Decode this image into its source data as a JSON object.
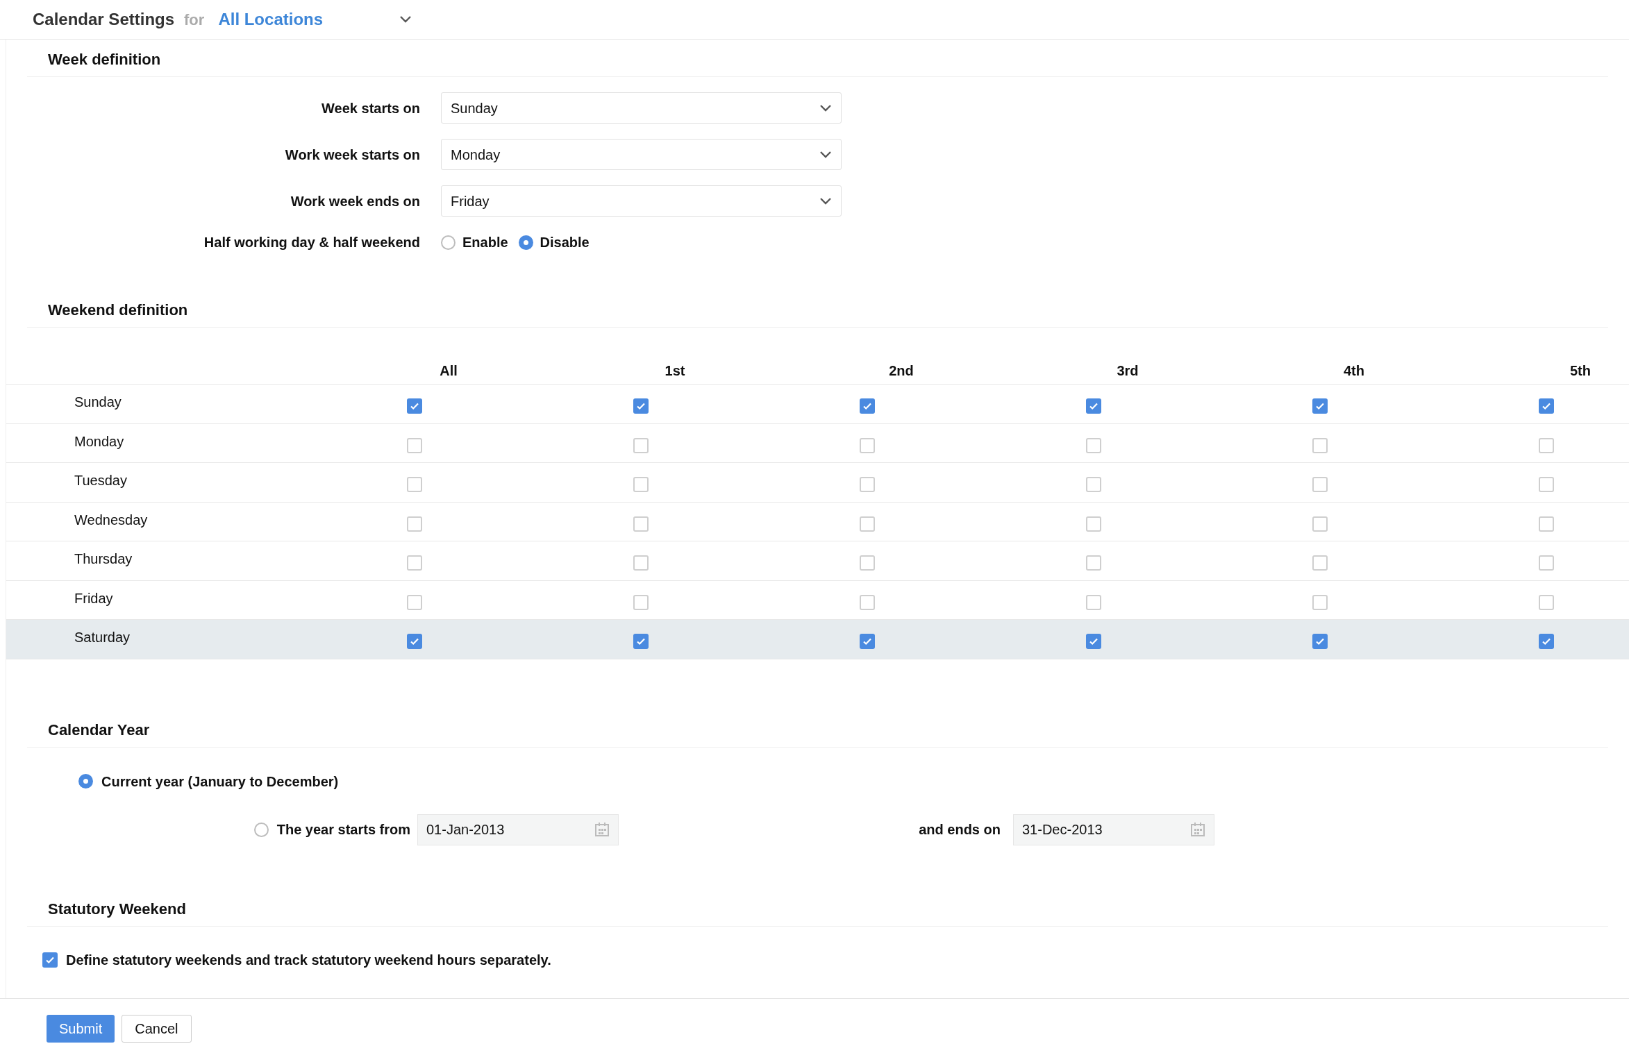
{
  "header": {
    "title": "Calendar Settings",
    "for_label": "for",
    "location": "All Locations"
  },
  "week_definition": {
    "title": "Week definition",
    "fields": [
      {
        "label": "Week starts on",
        "value": "Sunday"
      },
      {
        "label": "Work week starts on",
        "value": "Monday"
      },
      {
        "label": "Work week ends on",
        "value": "Friday"
      }
    ],
    "half_day": {
      "label": "Half working day & half weekend",
      "options": [
        {
          "label": "Enable",
          "selected": false
        },
        {
          "label": "Disable",
          "selected": true
        }
      ]
    }
  },
  "weekend_definition": {
    "title": "Weekend definition",
    "columns": [
      "All",
      "1st",
      "2nd",
      "3rd",
      "4th",
      "5th"
    ],
    "rows": [
      {
        "day": "Sunday",
        "highlighted": false,
        "checks": [
          true,
          true,
          true,
          true,
          true,
          true
        ]
      },
      {
        "day": "Monday",
        "highlighted": false,
        "checks": [
          false,
          false,
          false,
          false,
          false,
          false
        ]
      },
      {
        "day": "Tuesday",
        "highlighted": false,
        "checks": [
          false,
          false,
          false,
          false,
          false,
          false
        ]
      },
      {
        "day": "Wednesday",
        "highlighted": false,
        "checks": [
          false,
          false,
          false,
          false,
          false,
          false
        ]
      },
      {
        "day": "Thursday",
        "highlighted": false,
        "checks": [
          false,
          false,
          false,
          false,
          false,
          false
        ]
      },
      {
        "day": "Friday",
        "highlighted": false,
        "checks": [
          false,
          false,
          false,
          false,
          false,
          false
        ]
      },
      {
        "day": "Saturday",
        "highlighted": true,
        "checks": [
          true,
          true,
          true,
          true,
          true,
          true
        ]
      }
    ]
  },
  "calendar_year": {
    "title": "Calendar Year",
    "current": {
      "label": "Current year (January to December)",
      "selected": true
    },
    "custom": {
      "label": "The year starts from",
      "selected": false,
      "start": "01-Jan-2013",
      "end_label": "and ends on",
      "end": "31-Dec-2013"
    }
  },
  "statutory_weekend": {
    "title": "Statutory Weekend",
    "checkbox": {
      "label": "Define statutory weekends and track statutory weekend hours separately.",
      "checked": true
    }
  },
  "buttons": [
    {
      "label": "Submit",
      "kind": "primary"
    },
    {
      "label": "Cancel",
      "kind": "secondary"
    }
  ]
}
